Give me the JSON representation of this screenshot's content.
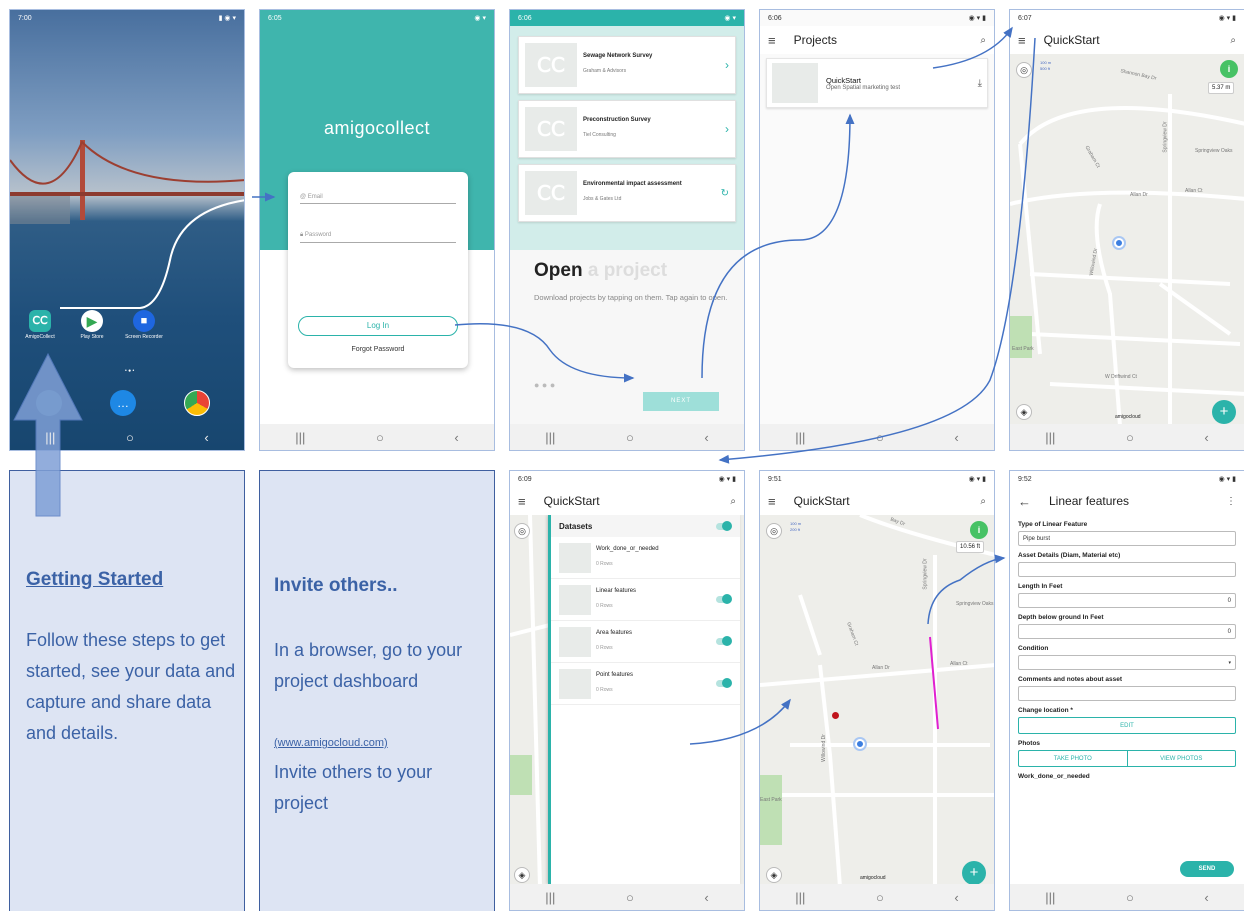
{
  "phone1": {
    "status_time": "7:00",
    "apps": [
      {
        "label": "AmigoCollect",
        "icon": "amigocollect-icon"
      },
      {
        "label": "Play Store",
        "icon": "play-store-icon"
      },
      {
        "label": "Screen Recorder",
        "icon": "screen-recorder-icon"
      }
    ]
  },
  "phone2": {
    "status_time": "6:05",
    "logo": "amigocollect",
    "email_placeholder": "Email",
    "password_placeholder": "Password",
    "login_label": "Log In",
    "forgot_label": "Forgot Password"
  },
  "phone3": {
    "status_time": "6:06",
    "projects": [
      {
        "title": "Sewage Network Survey",
        "org": "Graham & Advisors"
      },
      {
        "title": "Preconstruction Survey",
        "org": "Tiel Consulting"
      },
      {
        "title": "Environmental impact assessment",
        "org": "Jobs & Gates Ltd"
      }
    ],
    "heading_bold": "Open",
    "heading_light": "a project",
    "description": "Download projects by tapping on them. Tap again to open.",
    "next_label": "NEXT"
  },
  "phone4": {
    "status_time": "6:06",
    "title": "Projects",
    "project_title": "QuickStart",
    "project_sub": "Open Spatial marketing test"
  },
  "phone5": {
    "status_time": "6:07",
    "title": "QuickStart",
    "scale_top": "100 m",
    "scale_bottom": "500 ft",
    "distance": "5.37 m",
    "roads": [
      "Shannon Bay Dr",
      "Graham Ct",
      "Springview Dr",
      "Springview Oaks",
      "Allan Dr",
      "Allan Ct",
      "Willowind Dr",
      "East Park",
      "W Driftwind Ct",
      "amigocloud"
    ]
  },
  "phone6": {
    "status_time": "6:09",
    "title": "QuickStart",
    "datasets_label": "Datasets",
    "datasets": [
      {
        "name": "Work_done_or_needed",
        "rows": "0 Rows"
      },
      {
        "name": "Linear features",
        "rows": "0 Rows"
      },
      {
        "name": "Area features",
        "rows": "0 Rows"
      },
      {
        "name": "Point features",
        "rows": "0 Rows"
      }
    ]
  },
  "phone7": {
    "status_time": "9:51",
    "title": "QuickStart",
    "scale_top": "100 m",
    "scale_bottom": "200 ft",
    "distance": "10.56 ft",
    "roads": [
      "Bay Dr",
      "Springview Dr",
      "Graham Ct",
      "Springview Oaks",
      "Allan Dr",
      "Allan Ct",
      "Willowind Dr",
      "East Park",
      "amigocloud"
    ]
  },
  "phone8": {
    "status_time": "9:52",
    "title": "Linear features",
    "fields": [
      {
        "label": "Type of Linear Feature",
        "value": "Pipe burst"
      },
      {
        "label": "Asset Details (Diam, Material etc)",
        "value": ""
      },
      {
        "label": "Length In Feet",
        "value": "0"
      },
      {
        "label": "Depth below ground In Feet",
        "value": "0"
      },
      {
        "label": "Condition",
        "value": ""
      },
      {
        "label": "Comments and notes about asset",
        "value": ""
      }
    ],
    "change_location_label": "Change location *",
    "edit_label": "EDIT",
    "photos_label": "Photos",
    "take_photo_label": "TAKE PHOTO",
    "view_photos_label": "VIEW PHOTOS",
    "work_label": "Work_done_or_needed",
    "send_label": "SEND"
  },
  "panel1": {
    "title": "Getting Started",
    "body": "Follow these steps to get started, see your data and capture and share data and details."
  },
  "panel2": {
    "title": "Invite others..",
    "body1": "In a browser, go to your project dashboard",
    "link": "(www.amigocloud.com)",
    "body2": "Invite others to your project"
  },
  "colors": {
    "teal": "#2bb3aa",
    "panel_bg": "#dde4f3",
    "panel_text": "#3b62a6",
    "arrow": "#4472c4",
    "info_green": "#47c265"
  }
}
